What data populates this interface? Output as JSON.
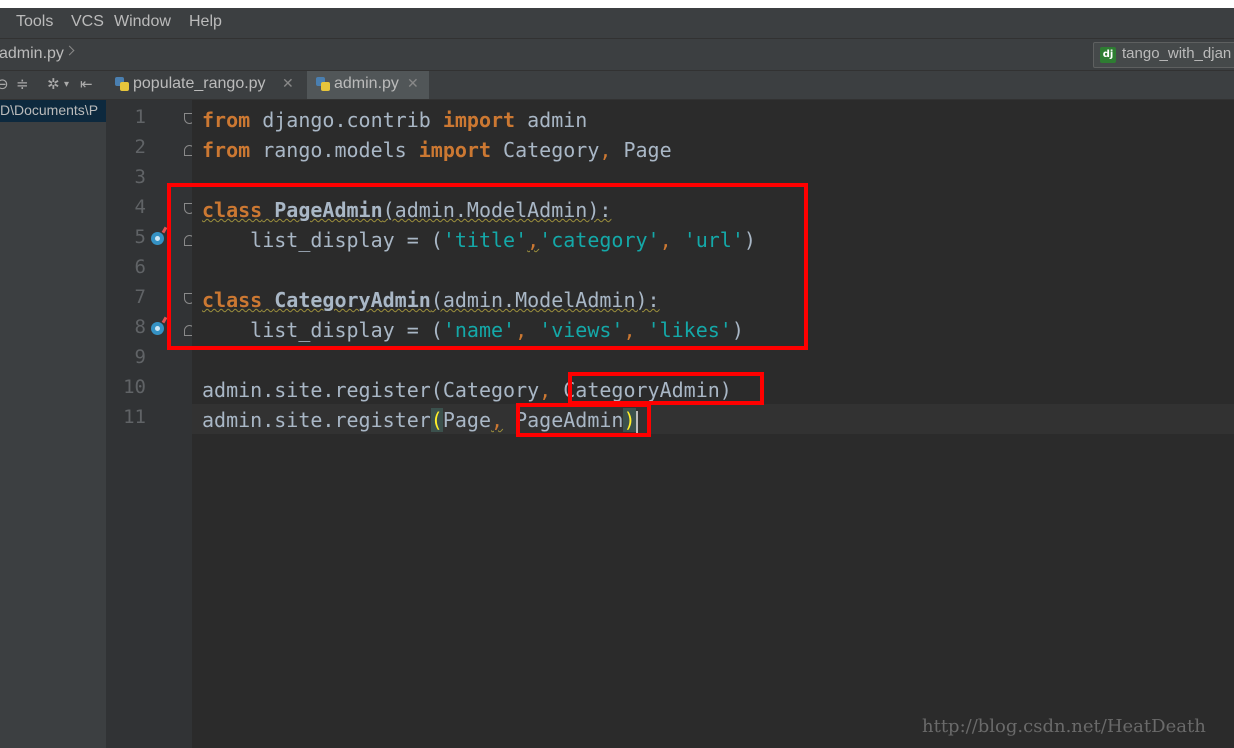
{
  "menu": {
    "items": [
      "Tools",
      "VCS",
      "Window",
      "Help"
    ]
  },
  "nav": {
    "breadcrumb": "admin.py",
    "run_config": "tango_with_djan",
    "run_config_icon": "dj"
  },
  "project_panel": {
    "path": "D\\Documents\\P"
  },
  "tabs": [
    {
      "label": "populate_rango.py",
      "active": false
    },
    {
      "label": "admin.py",
      "active": true
    }
  ],
  "editor": {
    "line_numbers": [
      "1",
      "2",
      "3",
      "4",
      "5",
      "6",
      "7",
      "8",
      "9",
      "10",
      "11"
    ],
    "code": {
      "l1": {
        "kw1": "from",
        "mod": " django.contrib ",
        "kw2": "import",
        "name": " admin"
      },
      "l2": {
        "kw1": "from",
        "mod": " rango.models ",
        "kw2": "import",
        "names": " Category",
        "comma": ",",
        "name2": " Page"
      },
      "l4": {
        "kw": "class",
        "cls": "PageAdmin",
        "base": "(admin.ModelAdmin):"
      },
      "l5": {
        "indent": "    list_display = (",
        "s1": "'title'",
        "c1": ",",
        "s2": "'category'",
        "c2": ", ",
        "s3": "'url'",
        "close": ")"
      },
      "l7": {
        "kw": "class",
        "cls": "CategoryAdmin",
        "base": "(admin.ModelAdmin):"
      },
      "l8": {
        "indent": "    list_display = (",
        "s1": "'name'",
        "c1": ", ",
        "s2": "'views'",
        "c2": ", ",
        "s3": "'likes'",
        "close": ")"
      },
      "l10": {
        "call": "admin.site.register(Category",
        "comma": ",",
        "arg": " CategoryAdmin",
        "close": ")"
      },
      "l11": {
        "call": "admin.site.register",
        "open": "(",
        "arg1": "Page",
        "comma": ",",
        "arg": " PageAdmin",
        "close": ")"
      }
    }
  },
  "watermark": "http://blog.csdn.net/HeatDeath",
  "colors": {
    "keyword": "#cc7832",
    "string": "#14a8a8",
    "default_text": "#a9b7c6",
    "annotation": "#ff0000"
  }
}
